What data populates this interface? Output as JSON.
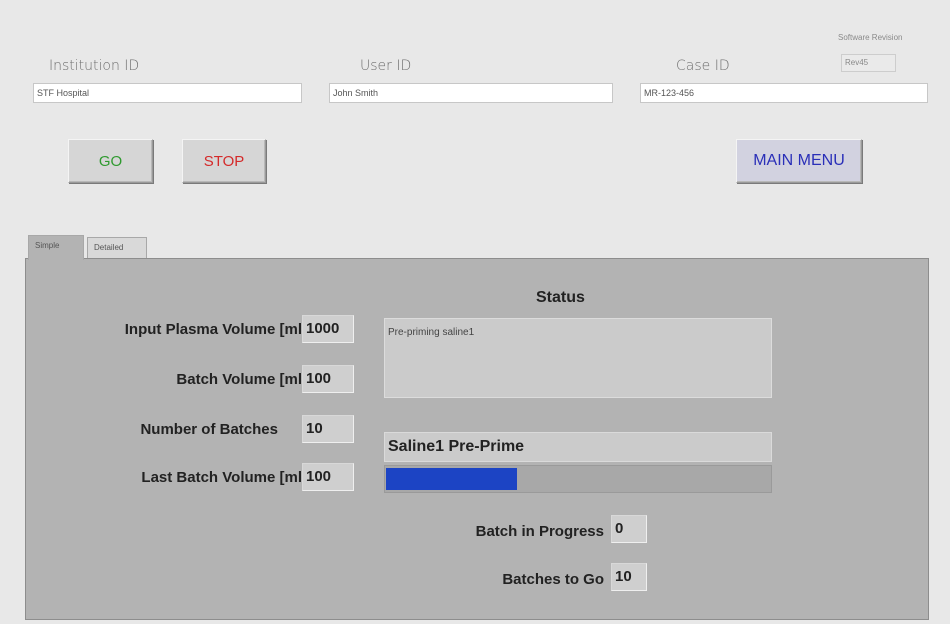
{
  "header": {
    "institution": {
      "label": "Institution ID",
      "value": "STF Hospital"
    },
    "user": {
      "label": "User ID",
      "value": "John Smith"
    },
    "case": {
      "label": "Case ID",
      "value": "MR-123-456"
    },
    "software_revision": {
      "label": "Software Revision",
      "value": "Rev45"
    }
  },
  "buttons": {
    "go": "GO",
    "stop": "STOP",
    "main_menu": "MAIN MENU"
  },
  "colors": {
    "go_text": "#2f9a2f",
    "stop_text": "#d42a2a",
    "main_menu_text": "#2a2fb8",
    "progress_fill": "#1c44c4",
    "panel_bg": "#b3b3b3"
  },
  "tabs": [
    {
      "label": "Simple",
      "active": true
    },
    {
      "label": "Detailed",
      "active": false
    }
  ],
  "panel": {
    "fields": [
      {
        "label": "Input Plasma Volume [ml]",
        "value": "1000"
      },
      {
        "label": "Batch Volume [ml]",
        "value": "100"
      },
      {
        "label": "Number of Batches",
        "value": "10"
      },
      {
        "label": "Last Batch Volume [ml]",
        "value": "100"
      }
    ],
    "status_title": "Status",
    "status_text": "Pre-priming saline1",
    "phase": "Saline1 Pre-Prime",
    "progress_fraction": 0.34,
    "batch_in_progress": {
      "label": "Batch in Progress",
      "value": "0"
    },
    "batches_to_go": {
      "label": "Batches to Go",
      "value": "10"
    }
  }
}
